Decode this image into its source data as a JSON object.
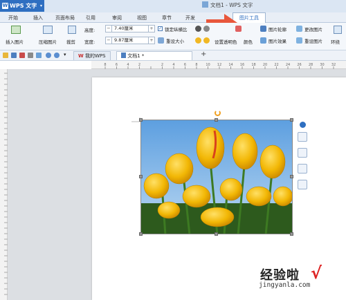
{
  "app": {
    "button_label": "WPS 文字",
    "logo_letter": "W",
    "window_title": "文档1 - WPS 文字"
  },
  "tabs": [
    "开始",
    "插入",
    "页面布局",
    "引用",
    "审阅",
    "视图",
    "章节",
    "开发",
    "图片工具"
  ],
  "ribbon": {
    "insert_picture": "插入图片",
    "compress_picture": "压缩图片",
    "crop": "裁剪",
    "height_label": "高度:",
    "height_value": "7.40厘米",
    "width_label": "宽度:",
    "width_value": "9.87厘米",
    "lock_ratio": "锁定纵横比",
    "reset_size": "重设大小",
    "set_transparent": "设置透明色",
    "color": "颜色",
    "picture_outline": "图片轮廓",
    "picture_effects": "图片效果",
    "change_picture": "更改图片",
    "reset_picture": "重设图片",
    "wrap": "环绕",
    "spin_minus": "−",
    "spin_plus": "+"
  },
  "doc_tabs": [
    "我的WPS",
    "文档1 *"
  ],
  "new_tab": "+",
  "ruler_numbers": [
    "8",
    "6",
    "4",
    "2",
    "",
    "2",
    "4",
    "6",
    "8",
    "10",
    "12",
    "14",
    "16",
    "18",
    "20",
    "22",
    "24",
    "26",
    "28",
    "30",
    "32"
  ],
  "watermark": {
    "text": "经验啦",
    "url": "jingyanla.com",
    "check": "√"
  },
  "colors": {
    "accent": "#2f6fc1",
    "arrow": "#e8573c",
    "tulip": "#f2b705",
    "sky": "#7fb4e6"
  }
}
